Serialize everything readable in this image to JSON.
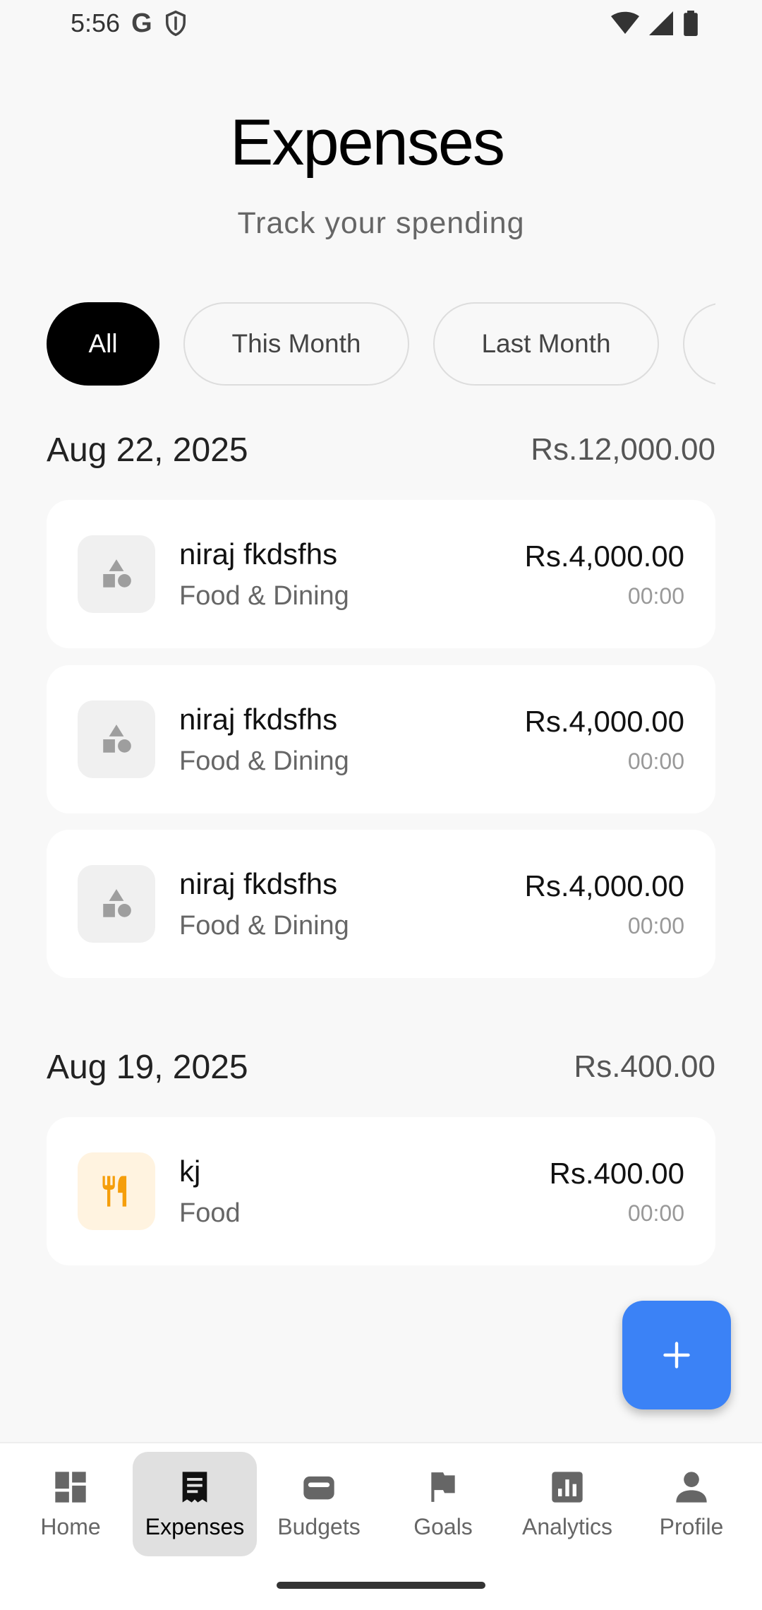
{
  "status_bar": {
    "time": "5:56"
  },
  "header": {
    "title": "Expenses",
    "subtitle": "Track your spending"
  },
  "filters": [
    "All",
    "This Month",
    "Last Month",
    ""
  ],
  "groups": [
    {
      "date": "Aug 22, 2025",
      "total": "Rs.12,000.00",
      "items": [
        {
          "name": "niraj fkdsfhs",
          "category": "Food & Dining",
          "amount": "Rs.4,000.00",
          "time": "00:00",
          "icon": "shapes-icon"
        },
        {
          "name": "niraj fkdsfhs",
          "category": "Food & Dining",
          "amount": "Rs.4,000.00",
          "time": "00:00",
          "icon": "shapes-icon"
        },
        {
          "name": "niraj fkdsfhs",
          "category": "Food & Dining",
          "amount": "Rs.4,000.00",
          "time": "00:00",
          "icon": "shapes-icon"
        }
      ]
    },
    {
      "date": "Aug 19, 2025",
      "total": "Rs.400.00",
      "items": [
        {
          "name": "kj",
          "category": "Food",
          "amount": "Rs.400.00",
          "time": "00:00",
          "icon": "restaurant-icon"
        }
      ]
    }
  ],
  "nav": [
    "Home",
    "Expenses",
    "Budgets",
    "Goals",
    "Analytics",
    "Profile"
  ],
  "colors": {
    "accent": "#3b82f6",
    "food_icon": "#f59e0b",
    "food_bg": "#fff3e0"
  }
}
